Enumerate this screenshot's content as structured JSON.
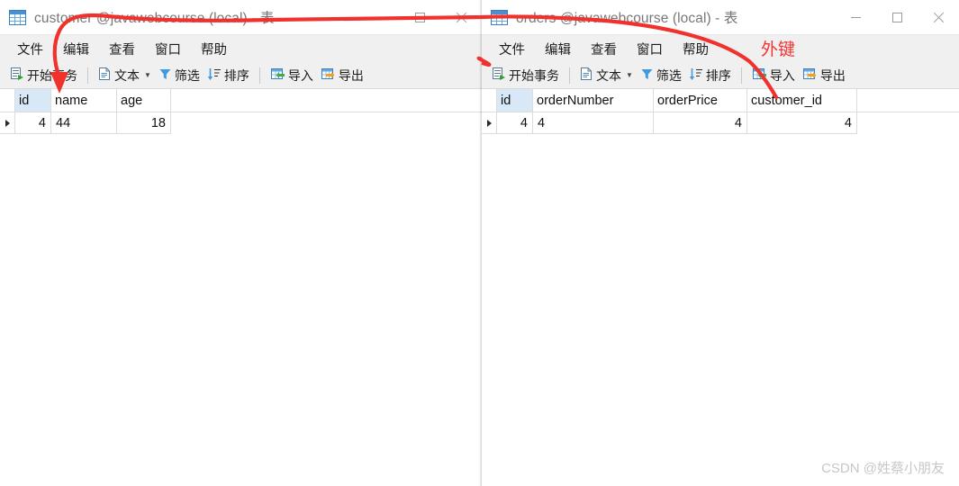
{
  "watermark": "CSDN @姓蔡小朋友",
  "annotations": {
    "foreign_key_label": "外键",
    "accent_color": "#f5342f",
    "arrow_description": "red curved arrow from orders.customer_id to customer.id"
  },
  "windows": [
    {
      "id": "customer",
      "titlebar": {
        "icon": "table-grid-icon",
        "title": "customer @javawebcourse (local) - 表",
        "controls": [
          {
            "name": "minimize-button",
            "glyph": "minimize-icon"
          },
          {
            "name": "maximize-button",
            "glyph": "maximize-icon"
          },
          {
            "name": "close-button",
            "glyph": "close-icon"
          }
        ]
      },
      "menubar": [
        {
          "label": "文件"
        },
        {
          "label": "编辑"
        },
        {
          "label": "查看"
        },
        {
          "label": "窗口"
        },
        {
          "label": "帮助"
        }
      ],
      "toolbar": [
        {
          "type": "button",
          "icon": "begin-transaction-icon",
          "label": "开始事务"
        },
        {
          "type": "separator"
        },
        {
          "type": "dropdown",
          "icon": "text-document-icon",
          "label": "文本",
          "caret": "▼"
        },
        {
          "type": "button",
          "icon": "filter-funnel-icon",
          "label": "筛选"
        },
        {
          "type": "button",
          "icon": "sort-descending-icon",
          "label": "排序"
        },
        {
          "type": "separator"
        },
        {
          "type": "button",
          "icon": "import-grid-icon",
          "label": "导入"
        },
        {
          "type": "button",
          "icon": "export-grid-icon",
          "label": "导出"
        }
      ],
      "grid": {
        "columns": [
          {
            "label": "id",
            "width": 40,
            "align": "right",
            "selected": true
          },
          {
            "label": "name",
            "width": 73,
            "align": "left",
            "selected": false
          },
          {
            "label": "age",
            "width": 60,
            "align": "right",
            "selected": false
          }
        ],
        "rows": [
          {
            "marker": "current-row",
            "cells": [
              "4",
              "44",
              "18"
            ]
          }
        ]
      }
    },
    {
      "id": "orders",
      "titlebar": {
        "icon": "table-grid-icon",
        "title": "orders @javawebcourse (local) - 表",
        "controls": [
          {
            "name": "minimize-button",
            "glyph": "minimize-icon"
          },
          {
            "name": "maximize-button",
            "glyph": "maximize-icon"
          },
          {
            "name": "close-button",
            "glyph": "close-icon"
          }
        ]
      },
      "menubar": [
        {
          "label": "文件"
        },
        {
          "label": "编辑"
        },
        {
          "label": "查看"
        },
        {
          "label": "窗口"
        },
        {
          "label": "帮助"
        }
      ],
      "toolbar": [
        {
          "type": "button",
          "icon": "begin-transaction-icon",
          "label": "开始事务"
        },
        {
          "type": "separator"
        },
        {
          "type": "dropdown",
          "icon": "text-document-icon",
          "label": "文本",
          "caret": "▼"
        },
        {
          "type": "button",
          "icon": "filter-funnel-icon",
          "label": "筛选"
        },
        {
          "type": "button",
          "icon": "sort-descending-icon",
          "label": "排序"
        },
        {
          "type": "separator"
        },
        {
          "type": "button",
          "icon": "import-grid-icon",
          "label": "导入"
        },
        {
          "type": "button",
          "icon": "export-grid-icon",
          "label": "导出"
        }
      ],
      "grid": {
        "columns": [
          {
            "label": "id",
            "width": 40,
            "align": "right",
            "selected": true
          },
          {
            "label": "orderNumber",
            "width": 134,
            "align": "left",
            "selected": false
          },
          {
            "label": "orderPrice",
            "width": 104,
            "align": "right",
            "selected": false
          },
          {
            "label": "customer_id",
            "width": 122,
            "align": "right",
            "selected": false
          }
        ],
        "rows": [
          {
            "marker": "current-row",
            "cells": [
              "4",
              "4",
              "4",
              "4"
            ]
          }
        ]
      }
    }
  ]
}
